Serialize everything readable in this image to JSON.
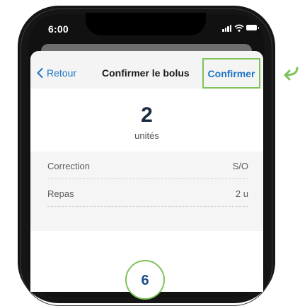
{
  "status_bar": {
    "time": "6:00",
    "signal_icon": "signal-icon",
    "wifi_icon": "wifi-icon",
    "battery_icon": "battery-icon"
  },
  "navbar": {
    "back_label": "Retour",
    "title": "Confirmer le bolus",
    "confirm_label": "Confirmer"
  },
  "dose": {
    "value": "2",
    "unit_label": "unités"
  },
  "details": [
    {
      "label": "Correction",
      "value": "S/O"
    },
    {
      "label": "Repas",
      "value": "2 u"
    }
  ],
  "annotation": {
    "step_number": "6",
    "highlight_color": "#7ec35a"
  },
  "colors": {
    "accent": "#1d75c4",
    "highlight": "#7ec35a",
    "dose_text": "#1a2a40"
  }
}
